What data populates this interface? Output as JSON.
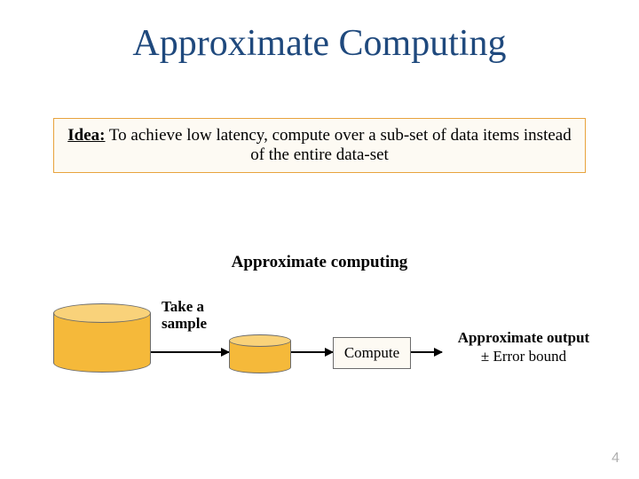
{
  "title": "Approximate Computing",
  "idea": {
    "label": "Idea:",
    "text": " To achieve low latency, compute over a sub-set of data items instead of the entire data-set"
  },
  "section_heading": "Approximate computing",
  "diagram": {
    "take_sample": "Take a sample",
    "compute": "Compute",
    "output_line1": "Approximate output",
    "output_line2": "± Error bound"
  },
  "page_number": "4"
}
